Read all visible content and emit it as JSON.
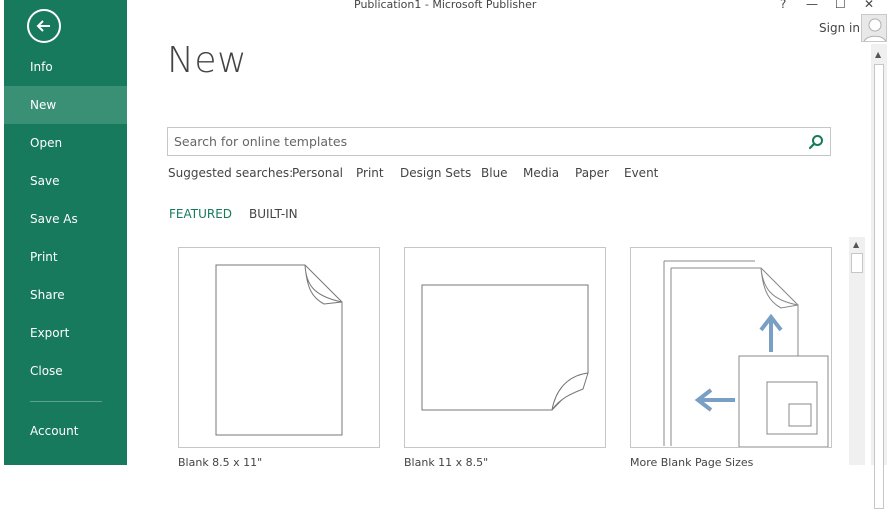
{
  "window": {
    "title": "Publication1 - Microsoft Publisher",
    "help": "?",
    "minimize": "—",
    "restore": "☐",
    "close": "✕",
    "sign_in": "Sign in"
  },
  "sidebar": {
    "items": [
      {
        "label": "Info"
      },
      {
        "label": "New"
      },
      {
        "label": "Open"
      },
      {
        "label": "Save"
      },
      {
        "label": "Save As"
      },
      {
        "label": "Print"
      },
      {
        "label": "Share"
      },
      {
        "label": "Export"
      },
      {
        "label": "Close"
      },
      {
        "label": "Account"
      }
    ],
    "active": "New"
  },
  "main": {
    "title": "New",
    "search_placeholder": "Search for online templates",
    "suggested_label": "Suggested searches:",
    "suggested": [
      "Personal",
      "Print",
      "Design Sets",
      "Blue",
      "Media",
      "Paper",
      "Event"
    ],
    "tabs": [
      {
        "label": "FEATURED"
      },
      {
        "label": "BUILT-IN"
      }
    ],
    "templates": [
      {
        "label": "Blank 8.5 x 11\""
      },
      {
        "label": "Blank 11 x 8.5\""
      },
      {
        "label": "More Blank Page Sizes"
      }
    ]
  },
  "colors": {
    "accent": "#177a5c",
    "accent_active": "#3a9074",
    "icon_blue": "#7a9fc4"
  }
}
